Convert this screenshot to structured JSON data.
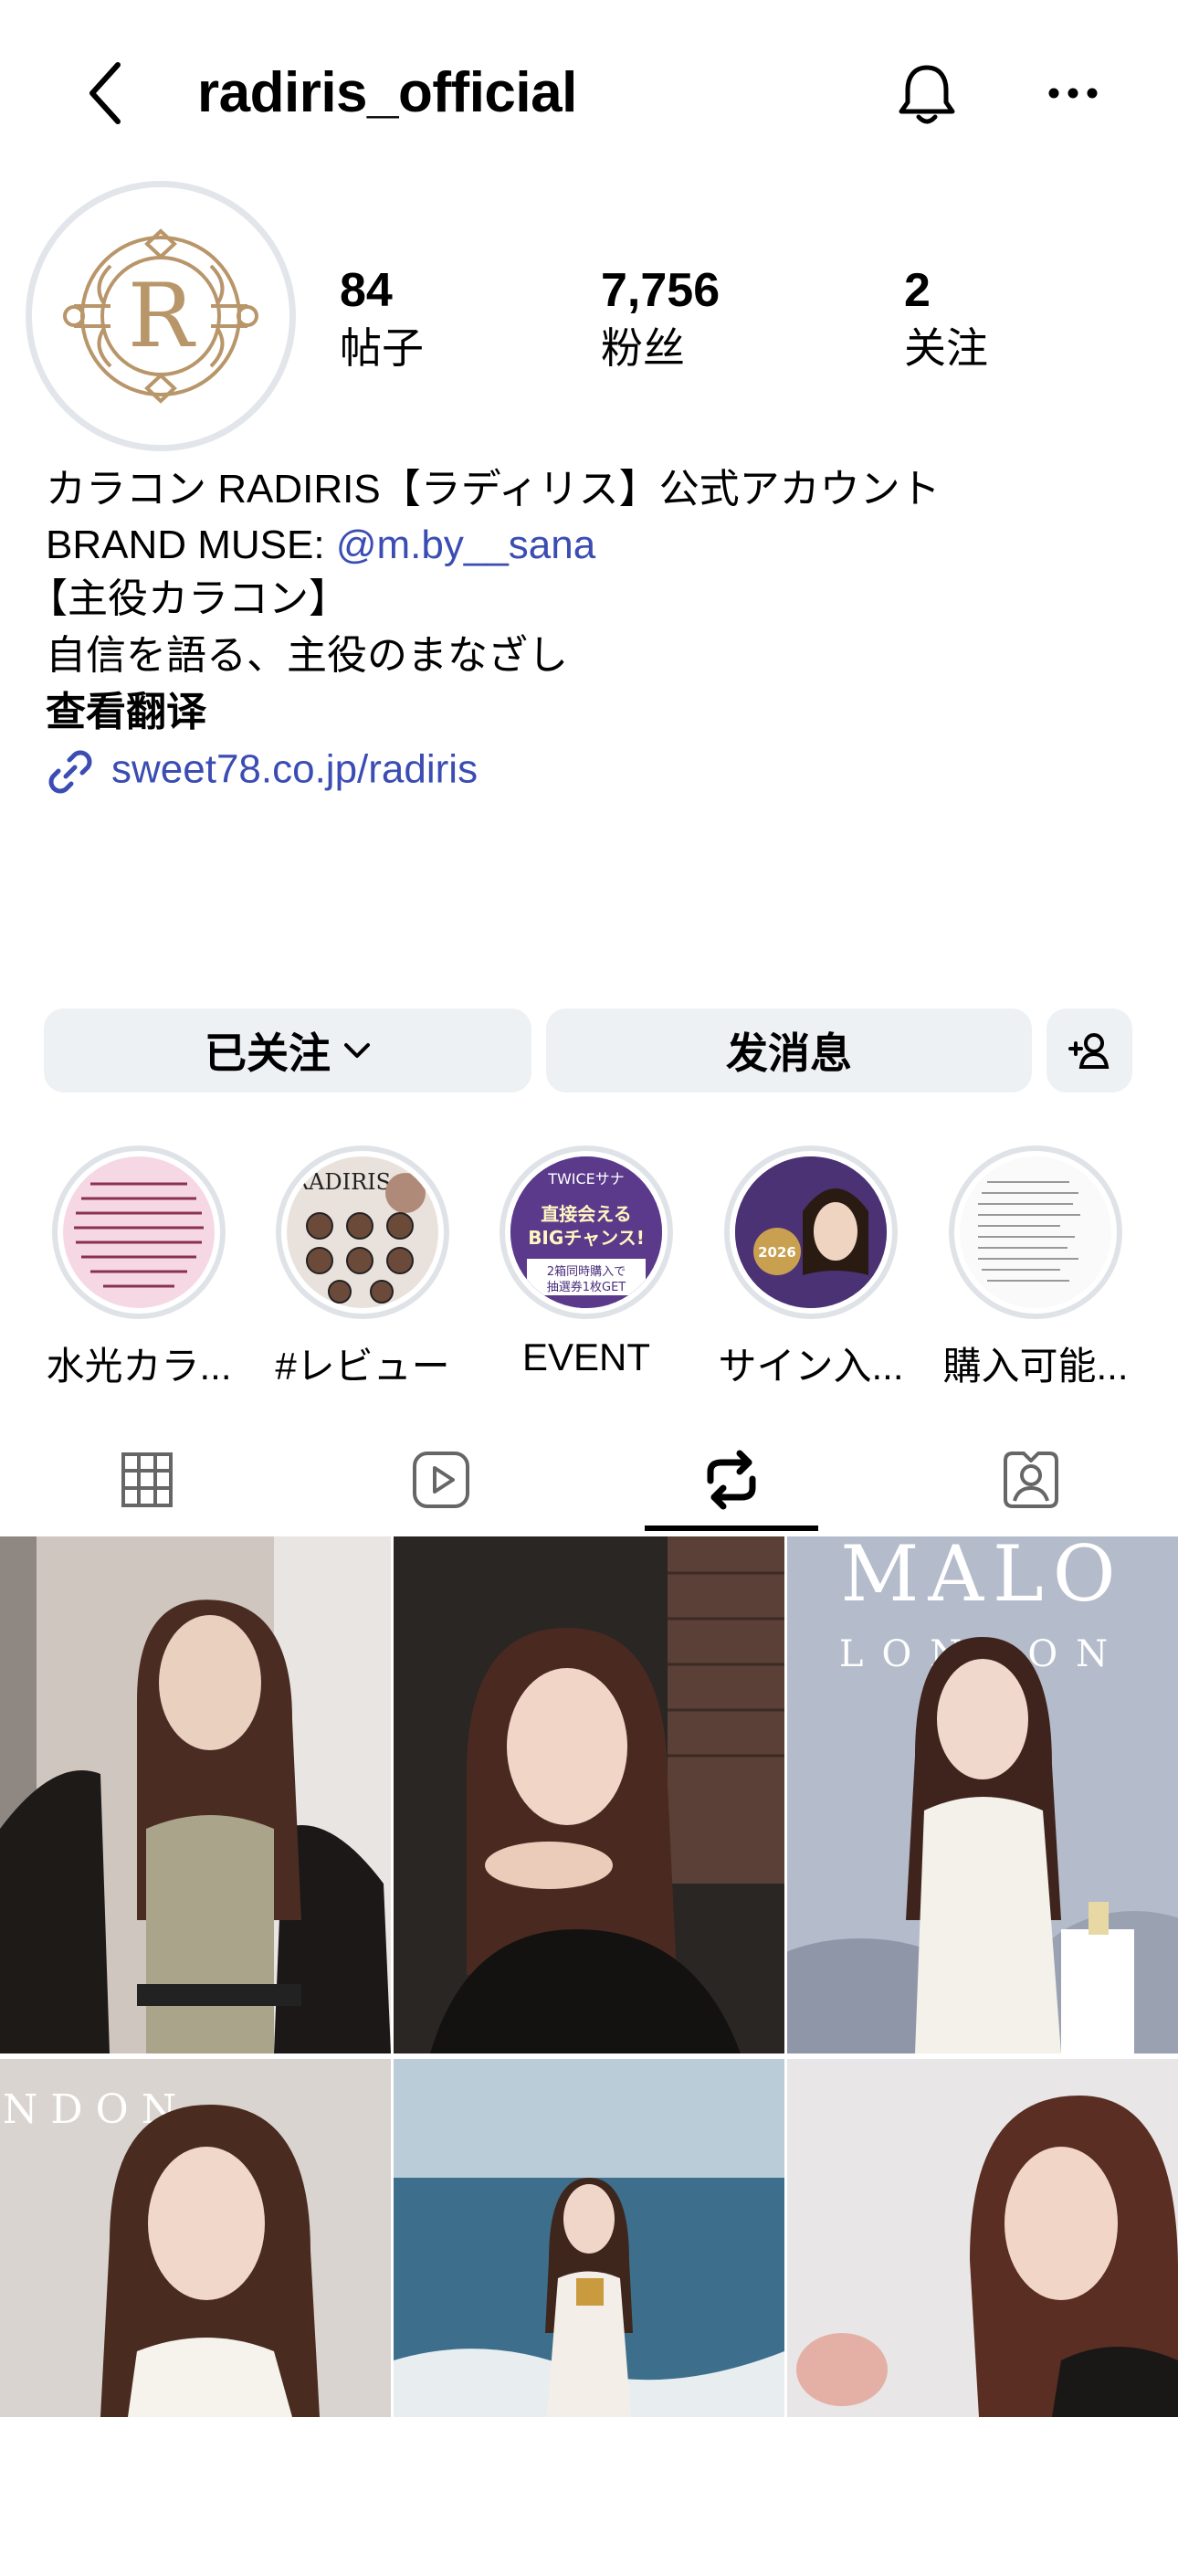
{
  "header": {
    "title": "radiris_official"
  },
  "stats": [
    {
      "value": "84",
      "label": "帖子"
    },
    {
      "value": "7,756",
      "label": "粉丝"
    },
    {
      "value": "2",
      "label": "关注"
    }
  ],
  "bio": {
    "line1": "カラコン RADIRIS【ラディリス】公式アカウント",
    "line2_prefix": "BRAND MUSE: ",
    "line2_mention": "@m.by__sana",
    "line3": "【主役カラコン】",
    "line4": "自信を語る、主役のまなざし",
    "translate": "查看翻译",
    "link": "sweet78.co.jp/radiris"
  },
  "actions": {
    "following_label": "已关注",
    "message_label": "发消息"
  },
  "highlights": [
    {
      "label": "水光カラ..."
    },
    {
      "label": "#レビュー"
    },
    {
      "label": "EVENT"
    },
    {
      "label": "サイン入..."
    },
    {
      "label": "購入可能..."
    }
  ],
  "highlight_texts": {
    "h2_banner": "RADIRIS",
    "h3_top": "TWICEサナ",
    "h3_main": "直接会える BIGチャンス!",
    "h3_bottom": "2箱同時購入で 抽選券1枚GET",
    "h4_badge": "2026"
  },
  "posts": {
    "tile3_text_top": "MALO",
    "tile3_text_sub": "LONDON",
    "tile4_text": "ONDON"
  },
  "colors": {
    "accent_link": "#3b4db3",
    "button_bg": "#eef1f4",
    "logo_gold": "#b8966a"
  }
}
